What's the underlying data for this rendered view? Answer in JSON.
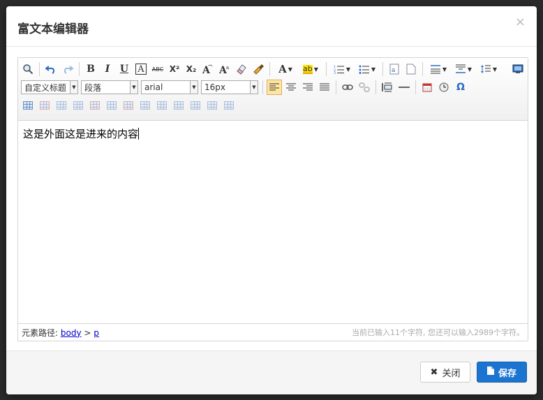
{
  "modal": {
    "title": "富文本编辑器",
    "close_glyph": "×"
  },
  "toolbar": {
    "heading_select": "自定义标题",
    "paragraph_select": "段落",
    "font_select": "arial",
    "size_select": "16px",
    "bold": "B",
    "italic": "I",
    "underline": "U",
    "border": "A",
    "strike": "ABC",
    "superscript": "X²",
    "subscript": "X₂",
    "font_color": "A",
    "highlight": "ab",
    "omega": "Ω"
  },
  "editor": {
    "content": "这是外面这是进来的内容"
  },
  "statusbar": {
    "path_label": "元素路径:",
    "path_body": "body",
    "path_sep": ">",
    "path_p": "p",
    "count_text": "当前已输入11个字符, 您还可以输入2989个字符。"
  },
  "footer": {
    "close_label": "关闭",
    "save_label": "保存",
    "close_icon": "✖",
    "save_icon": "▇"
  },
  "colors": {
    "primary": "#1b75d0",
    "active_bg": "#ffe69f"
  }
}
